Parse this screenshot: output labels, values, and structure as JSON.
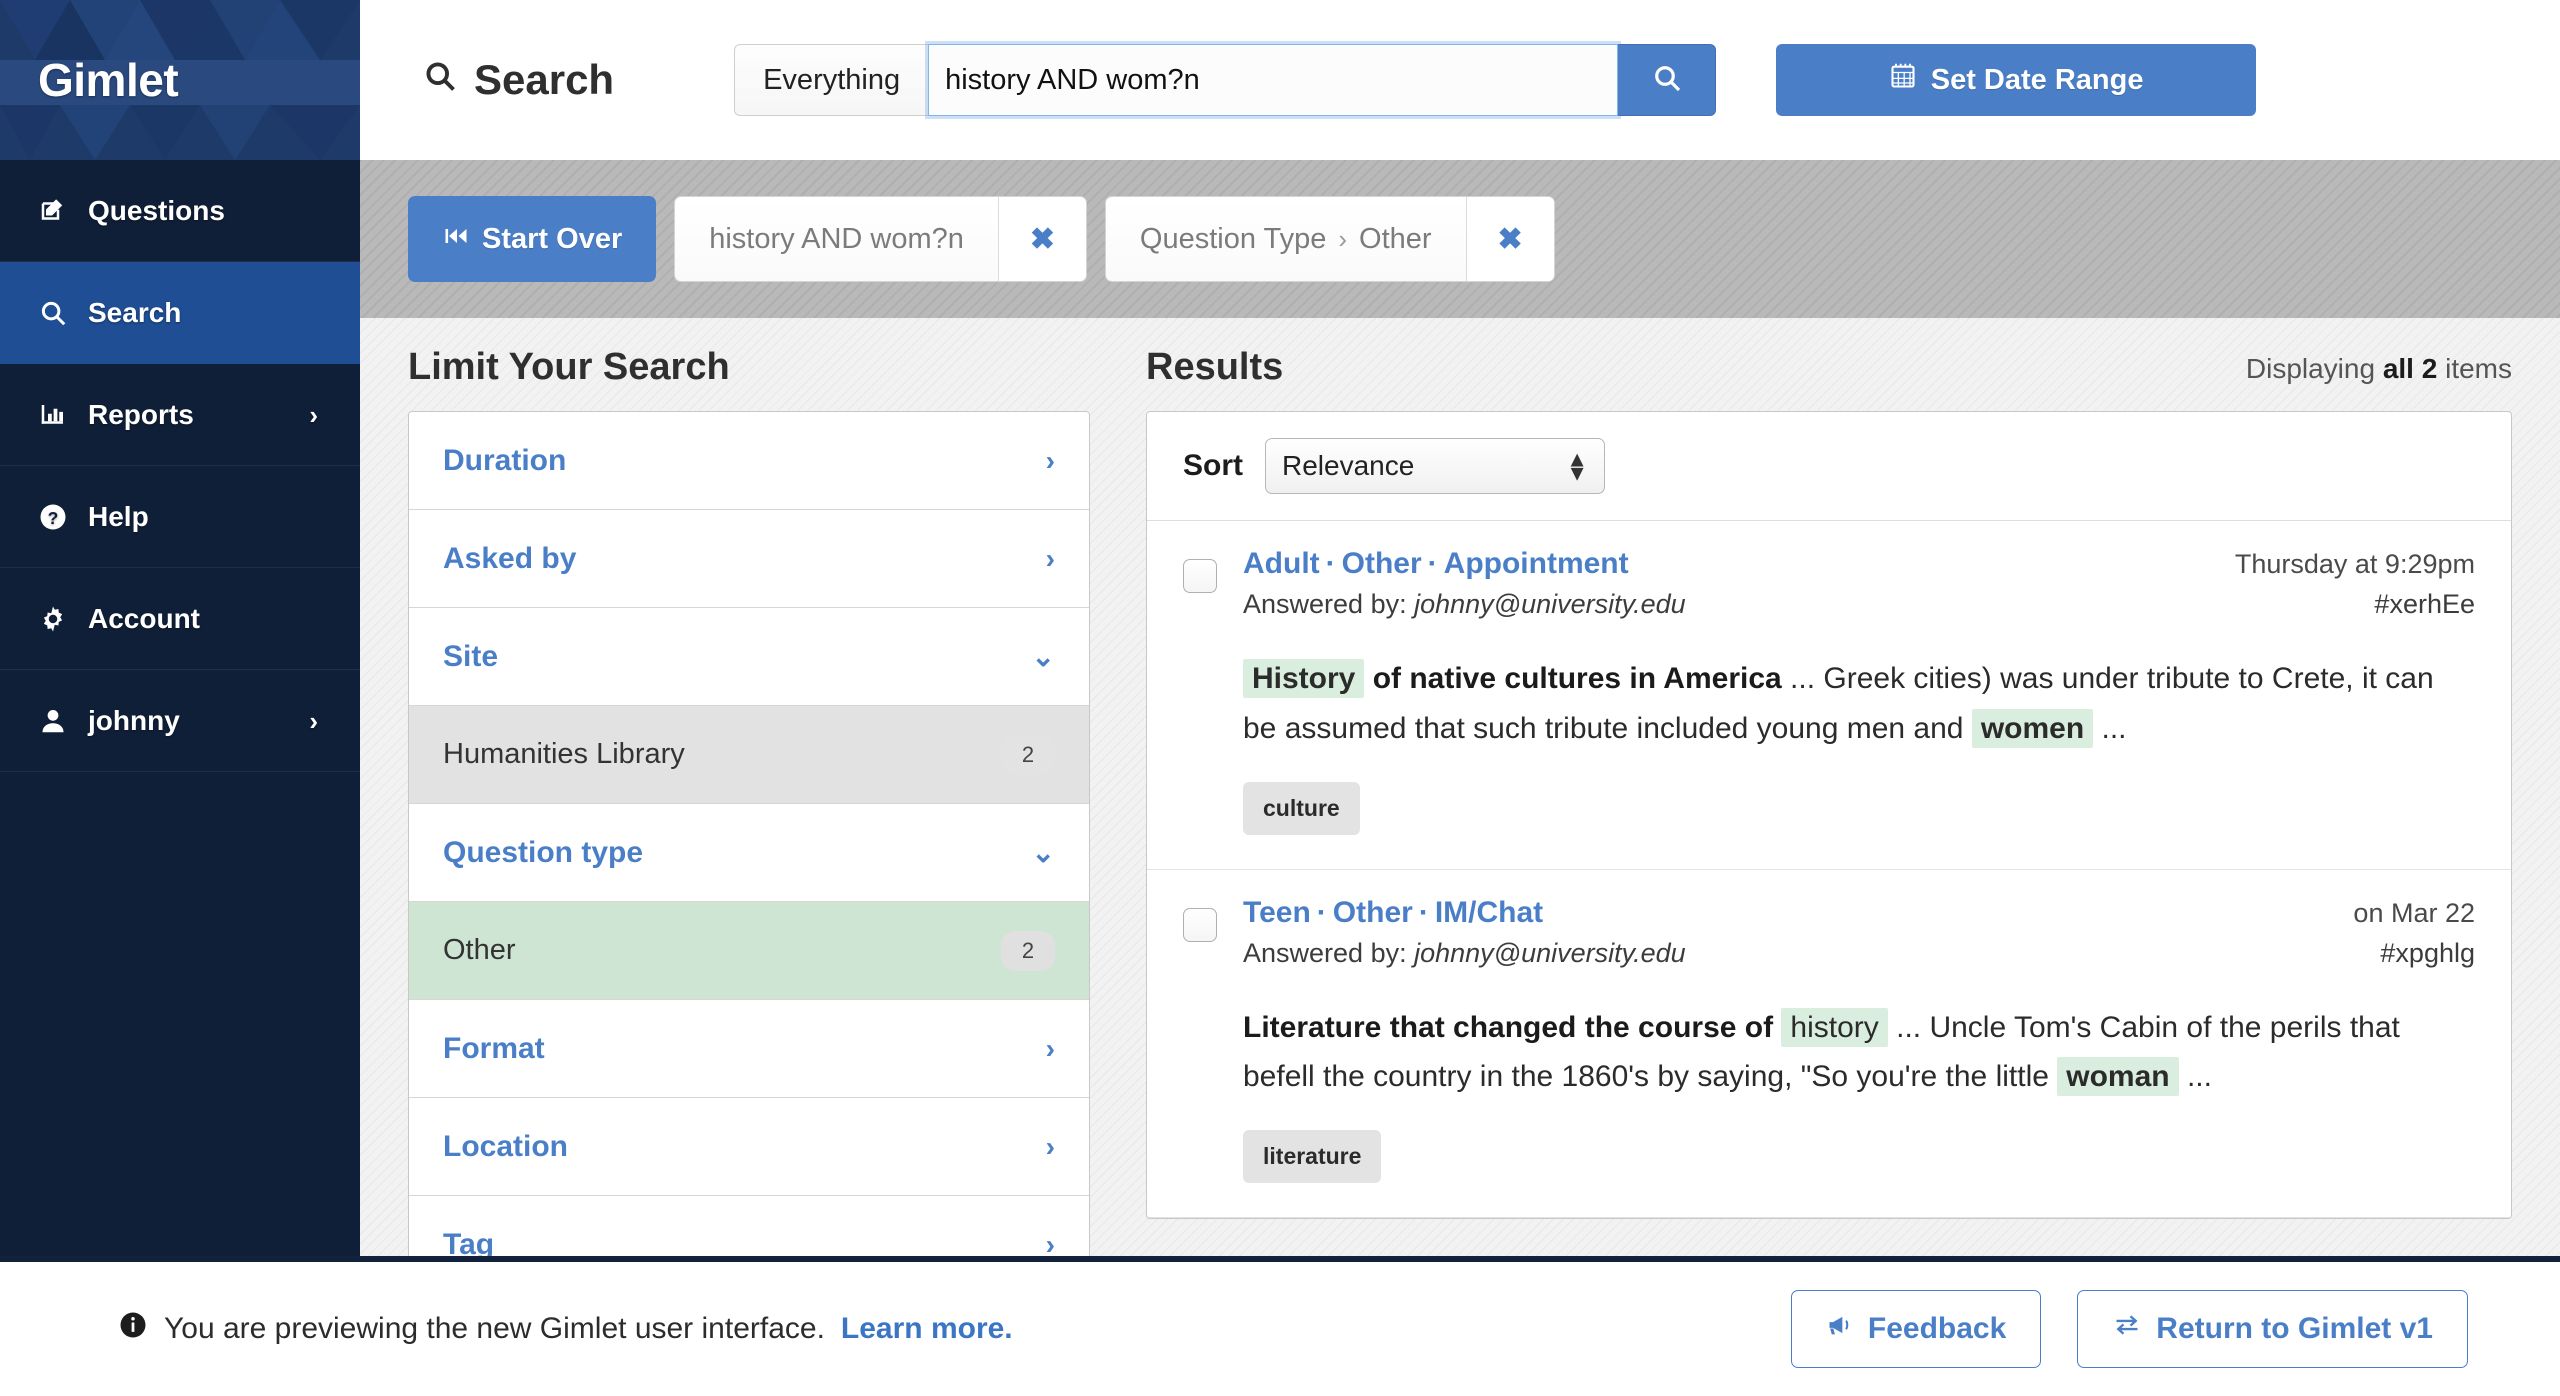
{
  "sidebar": {
    "brand": "Gimlet",
    "items": [
      {
        "label": "Questions",
        "icon": "pencil-square-icon",
        "chevron": "",
        "active": false
      },
      {
        "label": "Search",
        "icon": "search-icon",
        "chevron": "",
        "active": true
      },
      {
        "label": "Reports",
        "icon": "bar-chart-icon",
        "chevron": "›",
        "active": false
      },
      {
        "label": "Help",
        "icon": "question-circle-icon",
        "chevron": "",
        "active": false
      },
      {
        "label": "Account",
        "icon": "gear-icon",
        "chevron": "",
        "active": false
      },
      {
        "label": "johnny",
        "icon": "user-icon",
        "chevron": "›",
        "active": false
      }
    ]
  },
  "topbar": {
    "title": "Search",
    "scope_selected": "Everything",
    "query_value": "history AND wom?n",
    "query_placeholder": "",
    "search_button_icon": "search-icon",
    "date_range_label": "Set Date Range",
    "date_range_icon": "calendar-icon"
  },
  "filterbar": {
    "start_over_label": "Start Over",
    "start_over_icon": "rewind-icon",
    "pills": [
      {
        "label": "history AND wom?n",
        "prefix": "",
        "separator": "",
        "remove_icon": "close-icon"
      },
      {
        "label": "Other",
        "prefix": "Question Type",
        "separator": "›",
        "remove_icon": "close-icon"
      }
    ]
  },
  "facets": {
    "heading": "Limit Your Search",
    "groups": [
      {
        "label": "Duration",
        "expanded": false,
        "arrow": "›",
        "options": []
      },
      {
        "label": "Asked by",
        "expanded": false,
        "arrow": "›",
        "options": []
      },
      {
        "label": "Site",
        "expanded": true,
        "arrow": "⌄",
        "options": [
          {
            "label": "Humanities Library",
            "count": "2",
            "state": "plain"
          }
        ]
      },
      {
        "label": "Question type",
        "expanded": true,
        "arrow": "⌄",
        "options": [
          {
            "label": "Other",
            "count": "2",
            "state": "selected"
          }
        ]
      },
      {
        "label": "Format",
        "expanded": false,
        "arrow": "›",
        "options": []
      },
      {
        "label": "Location",
        "expanded": false,
        "arrow": "›",
        "options": []
      },
      {
        "label": "Tag",
        "expanded": false,
        "arrow": "›",
        "options": []
      }
    ]
  },
  "results": {
    "heading": "Results",
    "displaying_prefix": "Displaying ",
    "displaying_strong": "all 2",
    "displaying_suffix": " items",
    "sort_label": "Sort",
    "sort_selected": "Relevance",
    "items": [
      {
        "title_parts": [
          "Adult",
          "Other",
          "Appointment"
        ],
        "date": "Thursday at 9:29pm",
        "answered_by_label": "Answered by: ",
        "answered_by": "johnny@university.edu",
        "id": "#xerhEe",
        "snippet": [
          {
            "text": "History",
            "style": "hl-bold"
          },
          {
            "text": " of native cultures in America",
            "style": "bold"
          },
          {
            "text": " ... Greek cities) was under tribute to Crete, it can be assumed that such tribute included young men and ",
            "style": "plain"
          },
          {
            "text": "women",
            "style": "hl-bold"
          },
          {
            "text": " ...",
            "style": "plain"
          }
        ],
        "tag": "culture"
      },
      {
        "title_parts": [
          "Teen",
          "Other",
          "IM/Chat"
        ],
        "date": "on Mar 22",
        "answered_by_label": "Answered by: ",
        "answered_by": "johnny@university.edu",
        "id": "#xpghlg",
        "snippet": [
          {
            "text": "Literature that changed the course of ",
            "style": "bold"
          },
          {
            "text": "history",
            "style": "hl-plain"
          },
          {
            "text": " ... Uncle Tom's Cabin of the perils that befell the country in the 1860's by saying, \"So you're the little ",
            "style": "plain"
          },
          {
            "text": "woman",
            "style": "hl-bold"
          },
          {
            "text": " ...",
            "style": "plain"
          }
        ],
        "tag": "literature"
      }
    ]
  },
  "footer": {
    "info_icon": "info-circle-icon",
    "message": "You are previewing the new Gimlet user interface.",
    "link": "Learn more.",
    "feedback_label": "Feedback",
    "feedback_icon": "megaphone-icon",
    "return_label": "Return to Gimlet v1",
    "return_icon": "swap-arrows-icon"
  },
  "colors": {
    "brand_dark": "#101f38",
    "brand_header": "#1d3a68",
    "accent_blue": "#4a7fc8",
    "active_nav": "#1f4e95",
    "highlight_green": "#d9eede",
    "selected_facet": "#cee5d4"
  }
}
